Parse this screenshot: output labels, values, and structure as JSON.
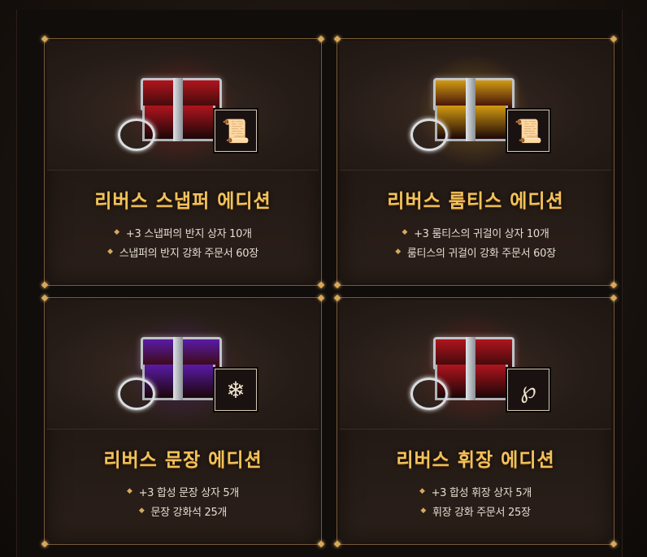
{
  "cards": [
    {
      "title": "리버스 스냅퍼 에디션",
      "items": [
        "+3 스냅퍼의 반지 상자 10개",
        "스냅퍼의 반지 강화 주문서 60장"
      ],
      "accent": "#b0141e",
      "icon": "scroll-icon",
      "icon_glyph": "📜"
    },
    {
      "title": "리버스 룸티스 에디션",
      "items": [
        "+3 룸티스의 귀걸이 상자 10개",
        "룸티스의 귀걸이 강화 주문서 60장"
      ],
      "accent": "#d29a12",
      "icon": "scroll-icon",
      "icon_glyph": "📜"
    },
    {
      "title": "리버스 문장 에디션",
      "items": [
        "+3 합성 문장 상자 5개",
        "문장 강화석 25개"
      ],
      "accent": "#5a1aa8",
      "icon": "snowflake-icon",
      "icon_glyph": "❄"
    },
    {
      "title": "리버스 휘장 에디션",
      "items": [
        "+3 합성 휘장 상자 5개",
        "휘장 강화 주문서 25장"
      ],
      "accent": "#b0141e",
      "icon": "rune-scroll-icon",
      "icon_glyph": "℘"
    }
  ],
  "bullet": "◆"
}
